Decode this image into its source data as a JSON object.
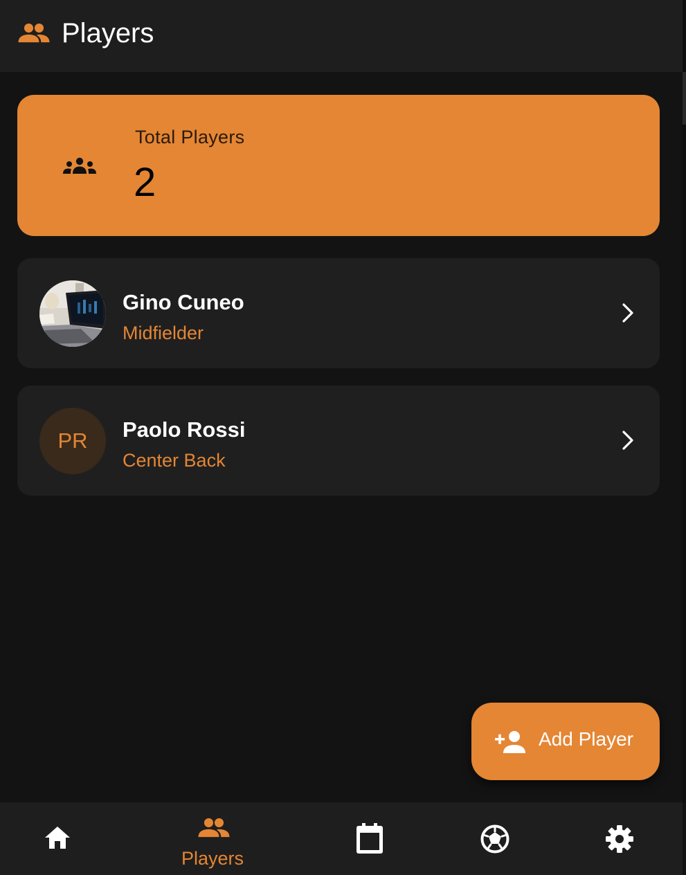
{
  "appbar": {
    "title": "Players",
    "icon": "people-icon"
  },
  "summary": {
    "label": "Total Players",
    "value": "2",
    "icon": "groups-icon"
  },
  "players": [
    {
      "name": "Gino Cuneo",
      "position": "Midfielder",
      "avatar": "photo"
    },
    {
      "name": "Paolo Rossi",
      "position": "Center Back",
      "initials": "PR"
    }
  ],
  "fab": {
    "label": "Add Player",
    "icon": "person-add-icon"
  },
  "nav": {
    "items": [
      {
        "id": "home",
        "icon": "home-icon",
        "label": ""
      },
      {
        "id": "players",
        "icon": "people-icon",
        "label": "Players",
        "active": true
      },
      {
        "id": "calendar",
        "icon": "calendar-icon",
        "label": ""
      },
      {
        "id": "matches",
        "icon": "soccer-ball-icon",
        "label": ""
      },
      {
        "id": "settings",
        "icon": "gear-icon",
        "label": ""
      }
    ]
  },
  "colors": {
    "accent": "#e48634",
    "background": "#131313",
    "surface": "#1f1f1f",
    "appbar": "#1e1e1e"
  }
}
